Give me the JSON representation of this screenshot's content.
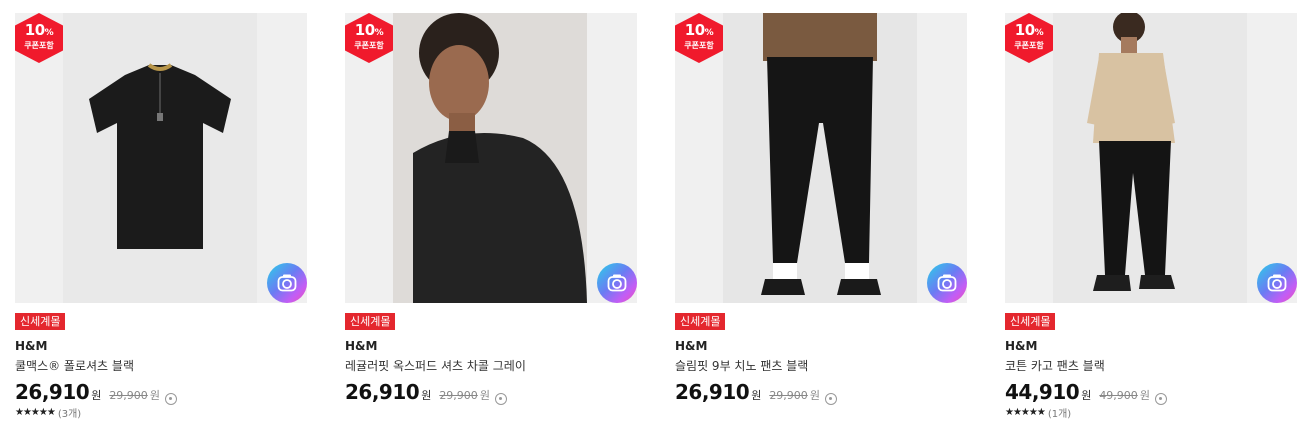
{
  "colors": {
    "coupon": "#f01a2c",
    "badge": "#e4272e",
    "price": "#111111"
  },
  "products": [
    {
      "coupon_percent": "10",
      "coupon_unit": "%",
      "coupon_label": "쿠폰포함",
      "image": "black-polo-shirt",
      "badge": "신세계몰",
      "brand": "H&M",
      "name": "쿨맥스® 폴로셔츠 블랙",
      "price": "26,910",
      "price_unit": "원",
      "original_price": "29,900",
      "original_unit": "원",
      "rating_stars": "★★★★★",
      "rating_count": "(3개)"
    },
    {
      "coupon_percent": "10",
      "coupon_unit": "%",
      "coupon_label": "쿠폰포함",
      "image": "model-oxford-shirt",
      "badge": "신세계몰",
      "brand": "H&M",
      "name": "레귤러핏 옥스퍼드 셔츠 차콜 그레이",
      "price": "26,910",
      "price_unit": "원",
      "original_price": "29,900",
      "original_unit": "원"
    },
    {
      "coupon_percent": "10",
      "coupon_unit": "%",
      "coupon_label": "쿠폰포함",
      "image": "model-chino-pants",
      "badge": "신세계몰",
      "brand": "H&M",
      "name": "슬림핏 9부 치노 팬츠 블랙",
      "price": "26,910",
      "price_unit": "원",
      "original_price": "29,900",
      "original_unit": "원"
    },
    {
      "coupon_percent": "10",
      "coupon_unit": "%",
      "coupon_label": "쿠폰포함",
      "image": "model-cargo-pants",
      "badge": "신세계몰",
      "brand": "H&M",
      "name": "코튼 카고 팬츠 블랙",
      "price": "44,910",
      "price_unit": "원",
      "original_price": "49,900",
      "original_unit": "원",
      "rating_stars": "★★★★★",
      "rating_count": "(1개)"
    }
  ]
}
